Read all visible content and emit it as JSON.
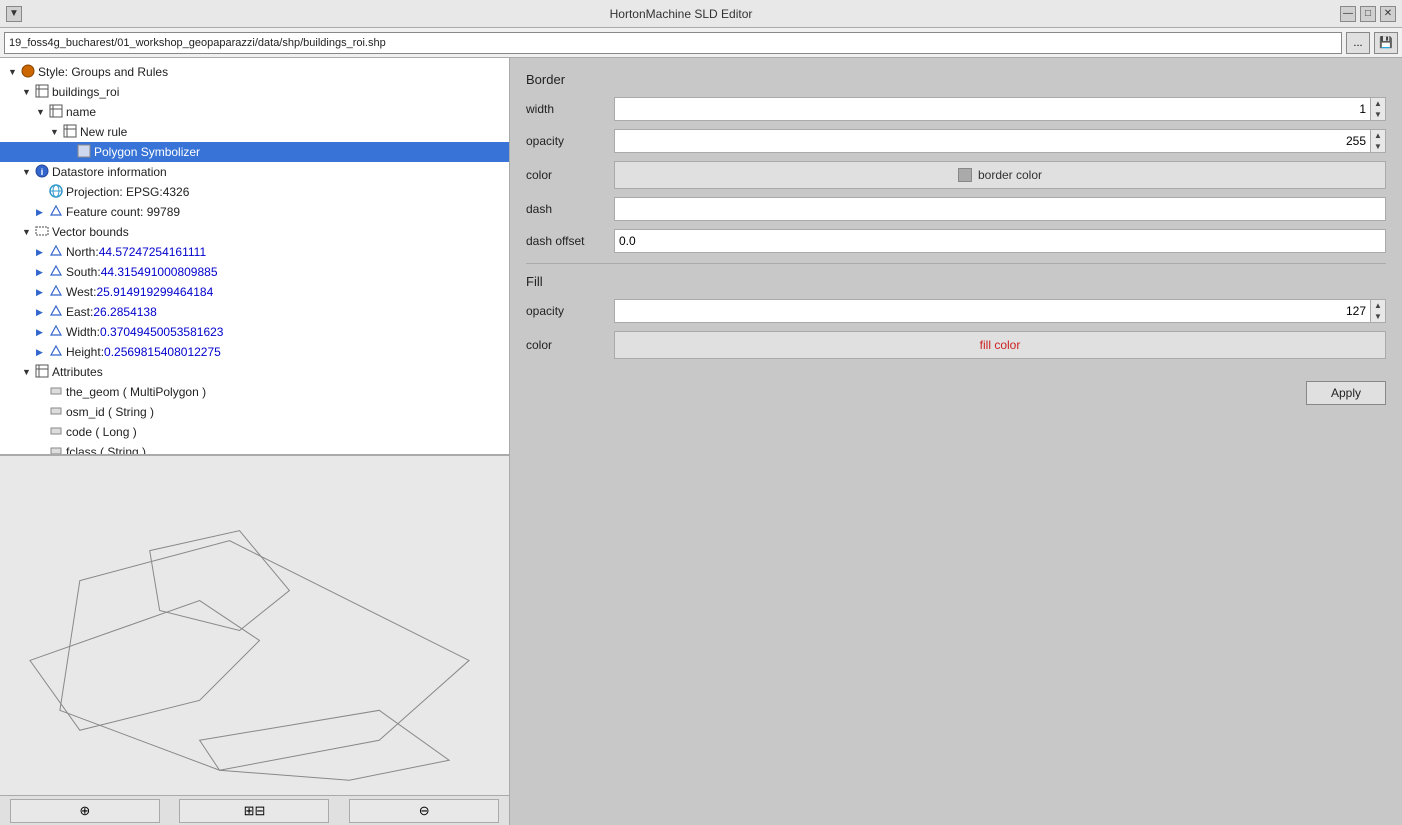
{
  "titleBar": {
    "title": "HortonMachine SLD Editor",
    "minBtn": "—",
    "maxBtn": "□",
    "closeBtn": "✕",
    "sysMenuBtn": "▼"
  },
  "filepath": {
    "value": "19_foss4g_bucharest/01_workshop_geopaparazzi/data/shp/buildings_roi.shp",
    "browseLabel": "...",
    "saveLabel": "💾"
  },
  "tree": {
    "items": [
      {
        "indent": 0,
        "arrow": "▼",
        "icon": "🔸",
        "label": "Style: Groups and Rules",
        "type": "style"
      },
      {
        "indent": 1,
        "arrow": "▼",
        "icon": "⊞",
        "label": "buildings_roi",
        "type": "layer"
      },
      {
        "indent": 2,
        "arrow": "▼",
        "icon": "⊞",
        "label": "name",
        "type": "group"
      },
      {
        "indent": 3,
        "arrow": "▼",
        "icon": "⊞",
        "label": "New rule",
        "type": "rule"
      },
      {
        "indent": 4,
        "arrow": "",
        "icon": "▪",
        "label": "Polygon Symbolizer",
        "type": "symbolizer",
        "selected": true
      },
      {
        "indent": 1,
        "arrow": "▼",
        "icon": "ℹ",
        "label": "Datastore information",
        "type": "info"
      },
      {
        "indent": 2,
        "arrow": "",
        "icon": "🌐",
        "label": "Projection: EPSG:4326",
        "type": "projection"
      },
      {
        "indent": 2,
        "arrow": "▶",
        "icon": "▶",
        "label": "Feature count: 99789",
        "type": "count"
      },
      {
        "indent": 1,
        "arrow": "▼",
        "icon": "⊡",
        "label": "Vector bounds",
        "type": "bounds"
      },
      {
        "indent": 2,
        "arrow": "▶",
        "icon": "▶",
        "label": "North: 44.57247254161111",
        "type": "coord",
        "isCoord": true
      },
      {
        "indent": 2,
        "arrow": "▶",
        "icon": "▶",
        "label": "South: 44.315491000809885",
        "type": "coord",
        "isCoord": true
      },
      {
        "indent": 2,
        "arrow": "▶",
        "icon": "▶",
        "label": "West: 25.914919299464184",
        "type": "coord",
        "isCoord": true
      },
      {
        "indent": 2,
        "arrow": "▶",
        "icon": "▶",
        "label": "East: 26.2854138",
        "type": "coord",
        "isCoord": true
      },
      {
        "indent": 2,
        "arrow": "▶",
        "icon": "▶",
        "label": "Width: 0.37049450053581623",
        "type": "coord",
        "isCoord": true
      },
      {
        "indent": 2,
        "arrow": "▶",
        "icon": "▶",
        "label": "Height: 0.2569815408012275",
        "type": "coord",
        "isCoord": true
      },
      {
        "indent": 1,
        "arrow": "▼",
        "icon": "⊞",
        "label": "Attributes",
        "type": "attributes"
      },
      {
        "indent": 2,
        "arrow": "",
        "icon": "⬛",
        "label": "the_geom ( MultiPolygon )",
        "type": "attr"
      },
      {
        "indent": 2,
        "arrow": "",
        "icon": "⬛",
        "label": "osm_id ( String )",
        "type": "attr"
      },
      {
        "indent": 2,
        "arrow": "",
        "icon": "⬛",
        "label": "code ( Long )",
        "type": "attr"
      },
      {
        "indent": 2,
        "arrow": "",
        "icon": "⬛",
        "label": "fclass ( String )",
        "type": "attr"
      }
    ]
  },
  "border": {
    "sectionLabel": "Border",
    "widthLabel": "width",
    "widthValue": "1",
    "opacityLabel": "opacity",
    "opacityValue": "255",
    "colorLabel": "color",
    "colorBtnLabel": "border color",
    "colorSwatchColor": "#aaaaaa",
    "dashLabel": "dash",
    "dashValue": "",
    "dashOffsetLabel": "dash offset",
    "dashOffsetValue": "0.0"
  },
  "fill": {
    "sectionLabel": "Fill",
    "opacityLabel": "opacity",
    "opacityValue": "127",
    "colorLabel": "color",
    "colorBtnLabel": "fill color"
  },
  "applyBtn": "Apply",
  "mapToolbar": {
    "zoomInBtn": "🔍",
    "zoomOutBtn": "⊕⊖",
    "panBtn": "🔍",
    "btn1Label": "⊕",
    "btn2Label": "⊞⊟",
    "btn3Label": "🔍"
  }
}
